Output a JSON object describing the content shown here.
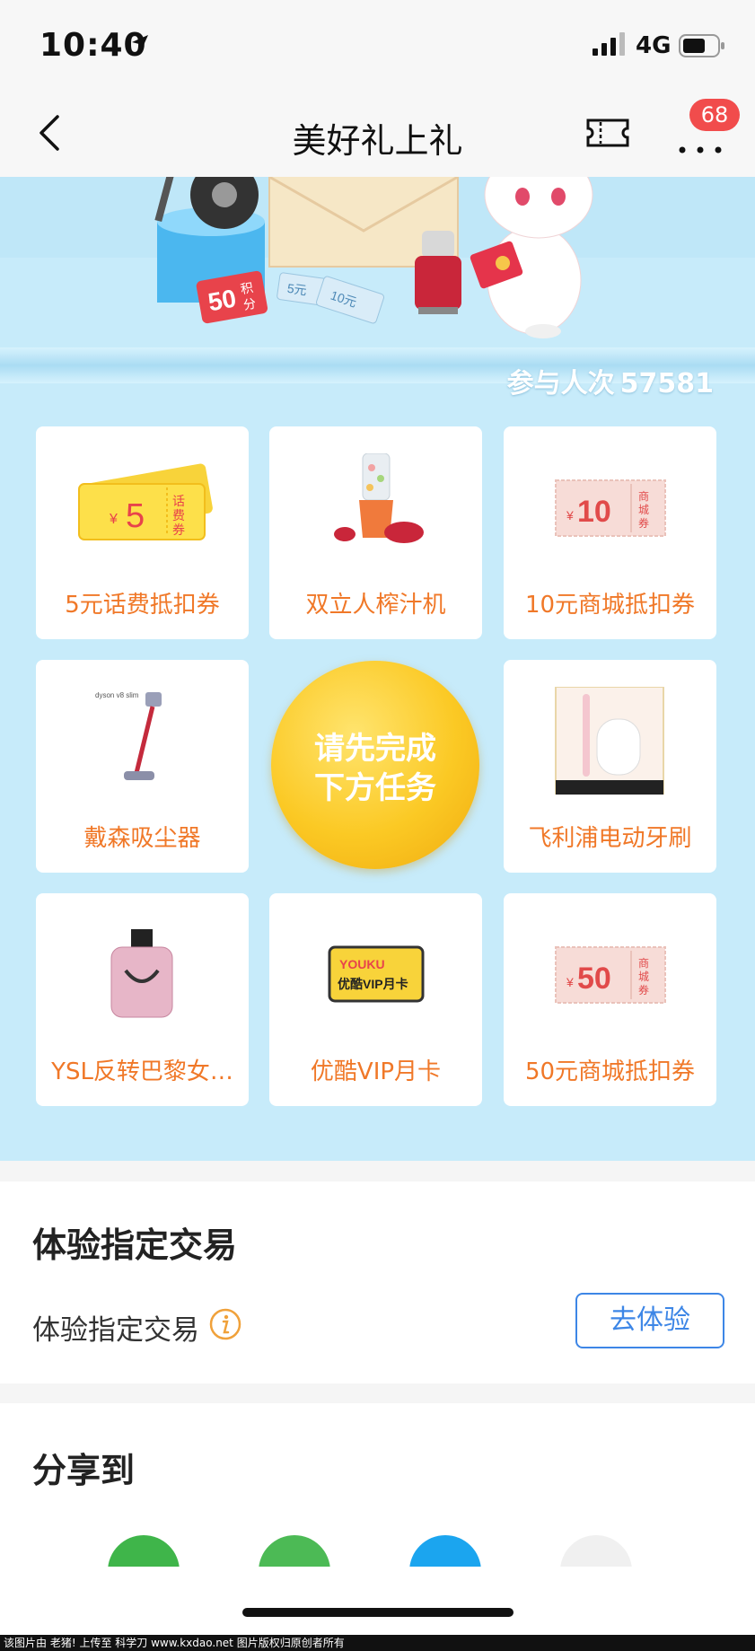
{
  "status": {
    "time": "10:40",
    "network": "4G"
  },
  "nav": {
    "title": "美好礼上礼",
    "badge": "68"
  },
  "banner": {
    "participants_label": "参与人次",
    "participants_count": "57581",
    "coupon_text": "50积分",
    "voucher_5": "5元",
    "voucher_10": "10元"
  },
  "prizes": [
    {
      "label": "5元话费抵扣券",
      "art": {
        "amount": "5",
        "unit": "¥",
        "tag": "话费券"
      }
    },
    {
      "label": "双立人榨汁机"
    },
    {
      "label": "10元商城抵扣券",
      "art": {
        "amount": "10",
        "unit": "¥",
        "tag": "商城券"
      }
    },
    {
      "label": "戴森吸尘器",
      "art": {
        "brand": "dyson v8 slim"
      }
    },
    {
      "label": "飞利浦电动牙刷"
    },
    {
      "label": "YSL反转巴黎女…"
    },
    {
      "label": "优酷VIP月卡",
      "art": {
        "brand": "YOUKU",
        "card": "优酷VIP月卡"
      }
    },
    {
      "label": "50元商城抵扣券",
      "art": {
        "amount": "50",
        "unit": "¥",
        "tag": "商城券"
      }
    }
  ],
  "center_button": {
    "line1": "请先完成",
    "line2": "下方任务"
  },
  "experience": {
    "title": "体验指定交易",
    "task_label": "体验指定交易",
    "button": "去体验"
  },
  "share": {
    "title": "分享到"
  },
  "footer": {
    "text": "该图片由 老猪! 上传至 科学刀 www.kxdao.net 图片版权归原创者所有"
  },
  "colors": {
    "accent_orange": "#f07828",
    "link_blue": "#3d86e6",
    "badge_red": "#f14c4c",
    "promo_bg": "#c7ebfa"
  }
}
